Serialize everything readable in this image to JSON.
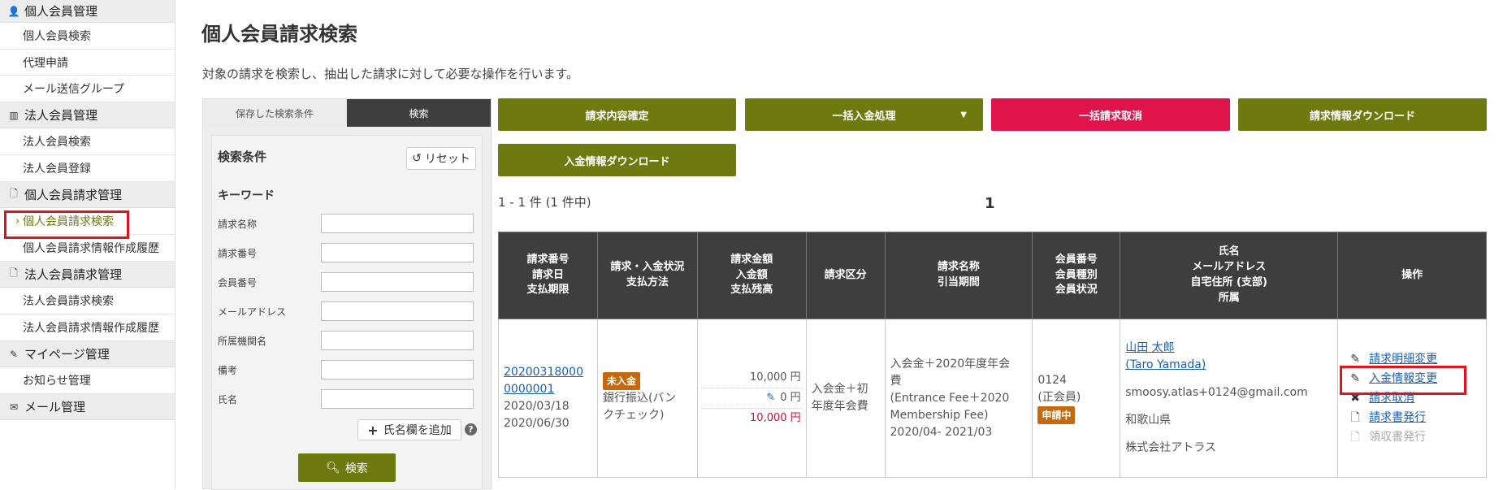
{
  "sidebar": {
    "sections": [
      {
        "label": "個人会員管理",
        "icon": "person-icon",
        "items": [
          {
            "label": "個人会員検索"
          },
          {
            "label": "代理申請"
          },
          {
            "label": "メール送信グループ"
          }
        ]
      },
      {
        "label": "法人会員管理",
        "icon": "building-icon",
        "items": [
          {
            "label": "法人会員検索"
          },
          {
            "label": "法人会員登録"
          }
        ]
      },
      {
        "label": "個人会員請求管理",
        "icon": "document-icon",
        "items": [
          {
            "label": "個人会員請求検索",
            "active": true
          },
          {
            "label": "個人会員請求情報作成履歴"
          }
        ]
      },
      {
        "label": "法人会員請求管理",
        "icon": "document-icon",
        "items": [
          {
            "label": "法人会員請求検索"
          },
          {
            "label": "法人会員請求情報作成履歴"
          }
        ]
      },
      {
        "label": "マイページ管理",
        "icon": "pencil-icon",
        "items": [
          {
            "label": "お知らせ管理"
          }
        ]
      },
      {
        "label": "メール管理",
        "icon": "mail-icon",
        "items": []
      }
    ]
  },
  "page": {
    "title": "個人会員請求検索",
    "description": "対象の請求を検索し、抽出した請求に対して必要な操作を行います。"
  },
  "search": {
    "tab_saved": "保存した検索条件",
    "tab_search": "検索",
    "conditions_title": "検索条件",
    "reset_label": "リセット",
    "keyword_label": "キーワード",
    "fields": [
      {
        "label": "請求名称",
        "value": ""
      },
      {
        "label": "請求番号",
        "value": ""
      },
      {
        "label": "会員番号",
        "value": ""
      },
      {
        "label": "メールアドレス",
        "value": ""
      },
      {
        "label": "所属機関名",
        "value": ""
      },
      {
        "label": "備考",
        "value": ""
      },
      {
        "label": "氏名",
        "value": ""
      }
    ],
    "add_name_label": "氏名欄を追加",
    "search_button": "検索"
  },
  "actions": {
    "confirm": "請求内容確定",
    "bulk_payment": "一括入金処理",
    "bulk_cancel": "一括請求取消",
    "download_invoice": "請求情報ダウンロード",
    "download_payment": "入金情報ダウンロード"
  },
  "results": {
    "count_text": "1 - 1 件 (1 件中)",
    "page": "1",
    "headers": {
      "col1": [
        "請求番号",
        "請求日",
        "支払期限"
      ],
      "col2": [
        "請求・入金状況",
        "支払方法"
      ],
      "col3": [
        "請求金額",
        "入金額",
        "支払残高"
      ],
      "col4": [
        "請求区分"
      ],
      "col5": [
        "請求名称",
        "引当期間"
      ],
      "col6": [
        "会員番号",
        "会員種別",
        "会員状況"
      ],
      "col7": [
        "氏名",
        "メールアドレス",
        "自宅住所 (支部)",
        "所属"
      ],
      "col8": [
        "操作"
      ]
    },
    "rows": [
      {
        "invoice_no_1": "20200318000",
        "invoice_no_2": "0000001",
        "invoice_date": "2020/03/18",
        "due_date": "2020/06/30",
        "status_badge": "未入金",
        "payment_method_1": "銀行振込(バン",
        "payment_method_2": "クチェック)",
        "amount_billed": "10,000 円",
        "amount_paid": "0 円",
        "balance": "10,000 円",
        "category_1": "入会金＋初",
        "category_2": "年度年会費",
        "name_1": "入会金＋2020年度年会",
        "name_2": "費",
        "name_3": "(Entrance Fee＋2020",
        "name_4": "Membership Fee)",
        "period": "2020/04- 2021/03",
        "member_no": "0124",
        "member_type": "(正会員)",
        "member_status": "申請中",
        "person_name": "山田 太郎",
        "person_name_en": "(Taro Yamada)",
        "email": "smoosy.atlas+0124@gmail.com",
        "address": "和歌山県",
        "affiliation": "株式会社アトラス",
        "ops": {
          "edit_details": "請求明細変更",
          "edit_payment": "入金情報変更",
          "cancel": "請求取消",
          "issue_invoice": "請求書発行",
          "issue_receipt": "領収書発行"
        }
      }
    ]
  },
  "colors": {
    "olive": "#6e7a10",
    "danger": "#e0144a",
    "header_dark": "#3e3e3e",
    "highlight_red": "#e0141e"
  }
}
